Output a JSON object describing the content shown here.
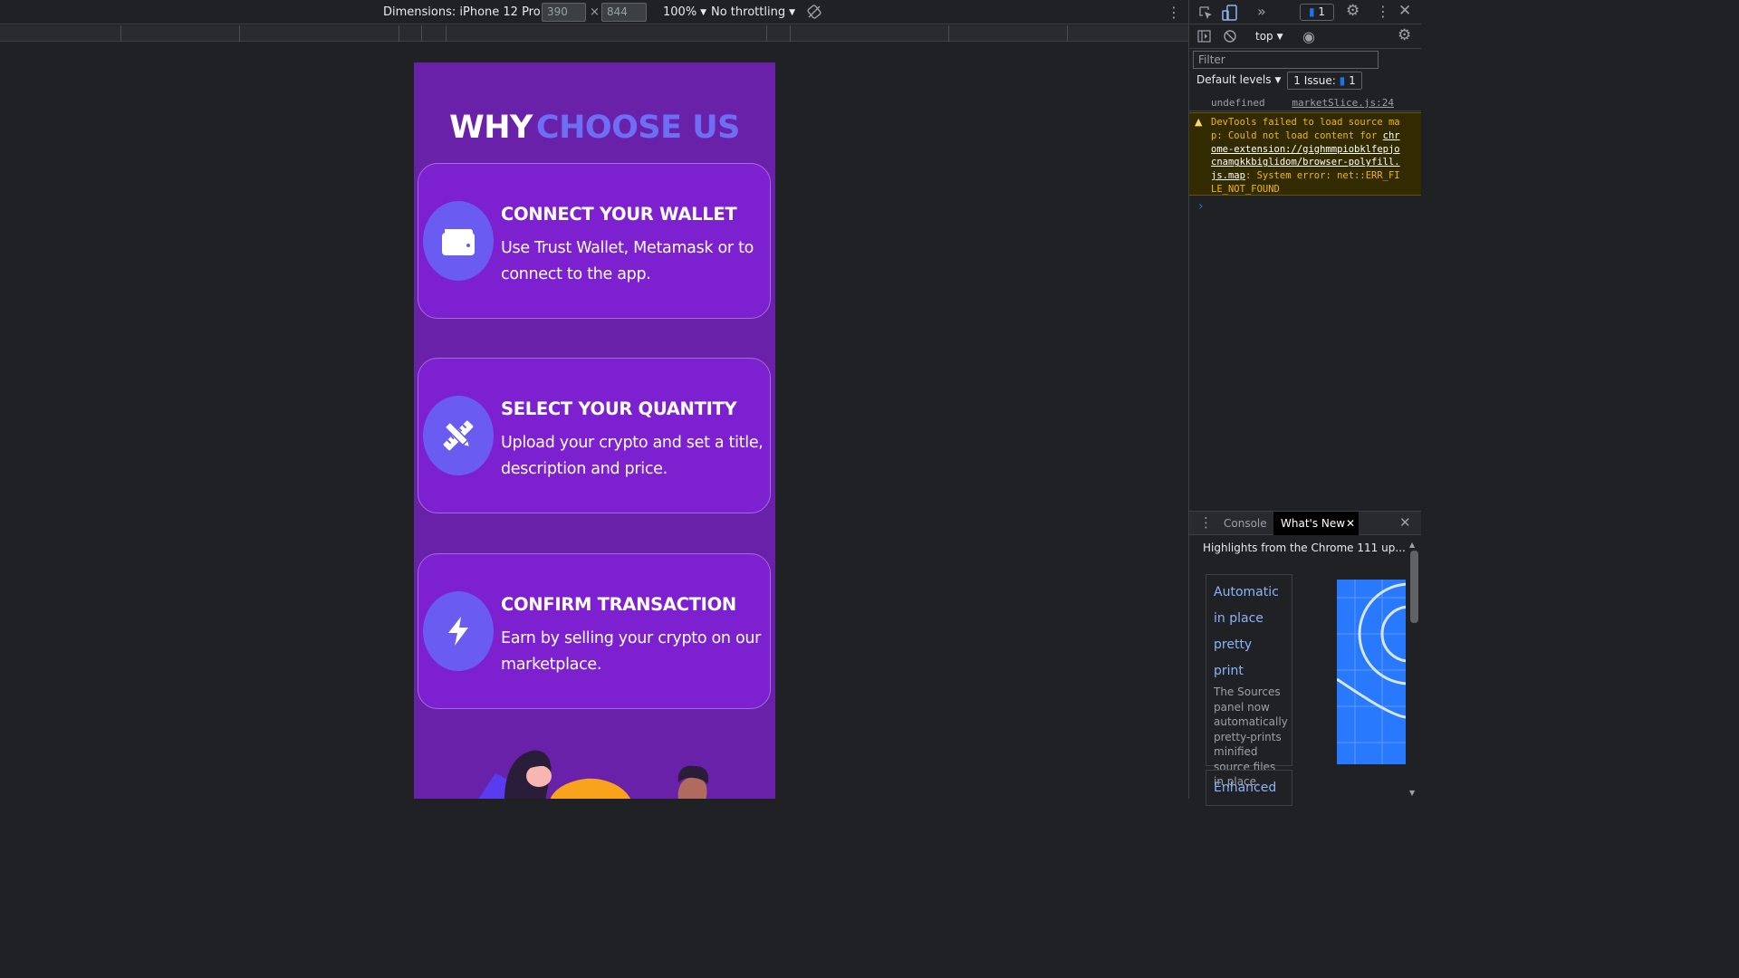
{
  "device_toolbar": {
    "dimensions_label": "Dimensions: iPhone 12 Pro",
    "width_value": "390",
    "height_value": "844",
    "times_sign": "×",
    "zoom_label": "100%",
    "throttle_label": "No throttling"
  },
  "page": {
    "heading_word1": "WHY",
    "heading_word2": "CHOOSE US",
    "cards": [
      {
        "icon": "wallet-icon",
        "title": "CONNECT YOUR WALLET",
        "description": "Use Trust Wallet, Metamask or to connect to the app."
      },
      {
        "icon": "pencil-ruler-icon",
        "title": "SELECT YOUR QUANTITY",
        "description": "Upload your crypto and set a title, description and price."
      },
      {
        "icon": "lightning-bolt-icon",
        "title": "CONFIRM TRANSACTION",
        "description": "Earn by selling your crypto on our marketplace."
      }
    ]
  },
  "devtools": {
    "issue_count": "1",
    "context_label": "top",
    "filter_placeholder": "Filter",
    "levels_label": "Default levels",
    "issues_label": "1 Issue:",
    "issues_count": "1",
    "log_value": "undefined",
    "log_source": "marketSlice.js:24",
    "warning_pre": "DevTools failed to load source map: Could not load content for ",
    "warning_link": "chrome-extension://gighmmpiobklfepjocnamgkkbiglidom/browser-polyfill.js.map",
    "warning_post": ": System error: net::ERR_FILE_NOT_FOUND",
    "prompt_symbol": "›",
    "drawer_tab_console": "Console",
    "drawer_tab_whats_new": "What's New",
    "whats_new_heading": "Highlights from the Chrome 111 up...",
    "whats_new_cards": [
      {
        "title": "Automatic in place pretty print",
        "body": "The Sources panel now automatically pretty-prints minified source files in place."
      },
      {
        "title": "Enhanced",
        "body": ""
      }
    ]
  },
  "colors": {
    "page_background": "#6a21a9",
    "card_background": "#7d20cf",
    "icon_circle": "#6a5cf0",
    "heading_accent": "#6e6ef5"
  }
}
